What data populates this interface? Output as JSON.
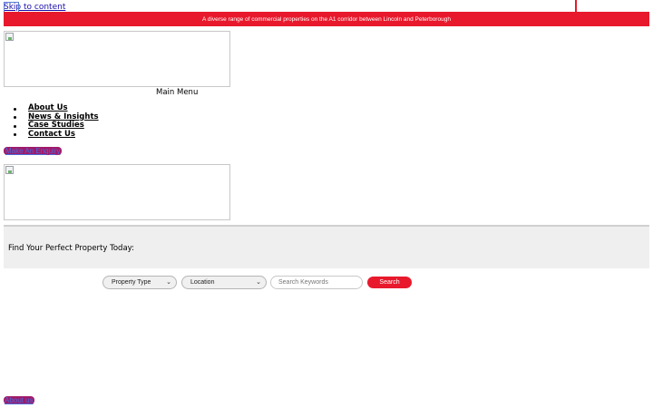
{
  "skip_link": {
    "label": "Skip to content"
  },
  "topbar": {
    "text": "A diverse range of commercial properties on the A1 corridor between Lincoln and Peterborough"
  },
  "header": {
    "menu_label": "Main Menu"
  },
  "nav": {
    "items": [
      {
        "label": "About Us"
      },
      {
        "label": "News & Insights"
      },
      {
        "label": "Case Studies"
      },
      {
        "label": "Contact Us"
      }
    ]
  },
  "cta": {
    "enquiry_label": "Make An Enquiry"
  },
  "search": {
    "heading": "Find Your Perfect Property Today:",
    "property_type": "Property Type",
    "location": "Location",
    "keywords_placeholder": "Search Keywords",
    "button_label": "Search"
  },
  "footer": {
    "about_label": "About us"
  },
  "colors": {
    "accent_red": "#e8192c",
    "button_purple": "#a01a6a",
    "link_blue": "#1a0dab"
  },
  "icons": {
    "broken_image": "broken-image-icon",
    "select_chevron": "chevron-down-icon"
  }
}
